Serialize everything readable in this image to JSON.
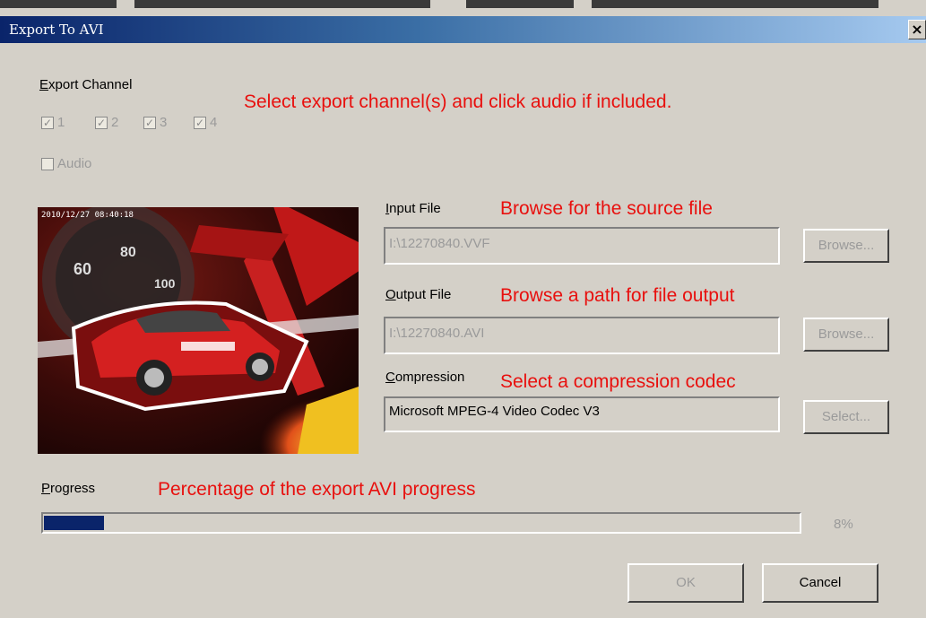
{
  "window": {
    "title": "Export To AVI",
    "close_glyph": "×"
  },
  "export_channel": {
    "label_u": "E",
    "label_rest": "xport Channel",
    "channels": [
      {
        "label": "1",
        "checked": true
      },
      {
        "label": "2",
        "checked": true
      },
      {
        "label": "3",
        "checked": true
      },
      {
        "label": "4",
        "checked": true
      }
    ],
    "audio": {
      "label": "Audio",
      "checked": false
    }
  },
  "preview": {
    "timestamp": "2010/12/27 08:40:18"
  },
  "input_file": {
    "label_u": "I",
    "label_rest": "nput File",
    "value": "I:\\12270840.VVF",
    "browse_label": "Browse..."
  },
  "output_file": {
    "label_u": "O",
    "label_rest": "utput File",
    "value": "I:\\12270840.AVI",
    "browse_label": "Browse..."
  },
  "compression": {
    "label_u": "C",
    "label_rest": "ompression",
    "value": "Microsoft MPEG-4 Video Codec V3",
    "select_label": "Select..."
  },
  "progress": {
    "label_u": "P",
    "label_rest": "rogress",
    "percent_text": "8%",
    "fraction": 0.08
  },
  "buttons": {
    "ok": "OK",
    "cancel": "Cancel"
  },
  "annotations": {
    "channel": "Select export channel(s) and click audio if included.",
    "input": "Browse for the source file",
    "output": "Browse a path for file output",
    "compression": "Select a compression codec",
    "progress": "Percentage of the export AVI progress"
  },
  "colors": {
    "annotation": "#e8100e",
    "progress_fill": "#0a246a",
    "dialog_bg": "#d4d0c8"
  }
}
